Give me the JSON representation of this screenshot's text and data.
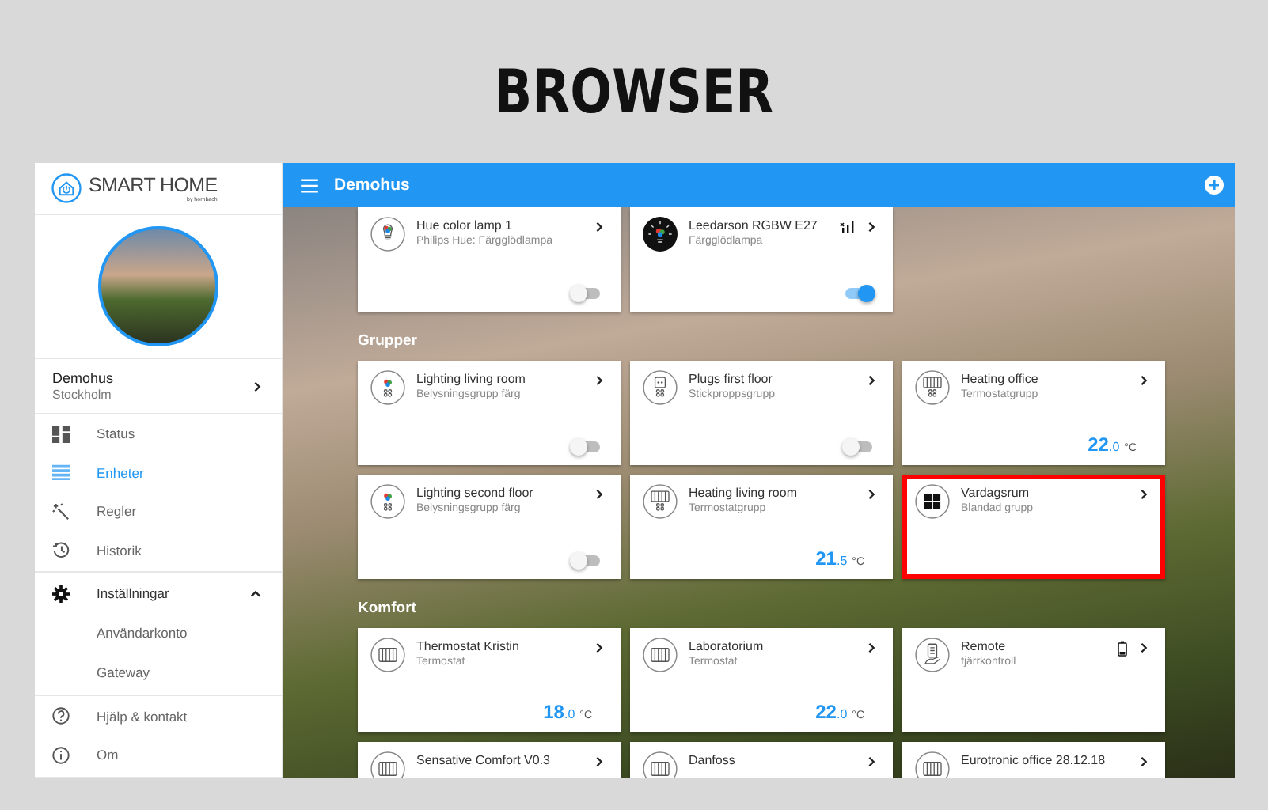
{
  "page_heading": "BROWSER",
  "sidebar": {
    "logo": {
      "title": "SMART HOME",
      "byline": "by hornbach"
    },
    "user": {
      "name": "Demohus",
      "location": "Stockholm"
    },
    "nav": [
      {
        "kind": "dashboard",
        "label": "Status",
        "selected": false
      },
      {
        "kind": "list",
        "label": "Enheter",
        "selected": true
      },
      {
        "kind": "wand",
        "label": "Regler",
        "selected": false
      },
      {
        "kind": "history",
        "label": "Historik",
        "selected": false
      },
      {
        "kind": "settings",
        "label": "Inställningar",
        "selected": false,
        "expanded": true,
        "children": [
          {
            "label": "Användarkonto",
            "selected": false
          },
          {
            "label": "Gateway",
            "selected": false
          }
        ]
      },
      {
        "kind": "help",
        "label": "Hjälp & kontakt",
        "selected": false
      },
      {
        "kind": "info",
        "label": "Om",
        "selected": false
      }
    ]
  },
  "topbar": {
    "title": "Demohus"
  },
  "sections": [
    {
      "cards": [
        {
          "kind": "lamp",
          "title": "Hue color lamp 1",
          "subtitle": "Philips Hue: Färgglödlampa",
          "toggle": {
            "on": false
          },
          "highlighted": false
        },
        {
          "kind": "lamp-dark",
          "title": "Leedarson RGBW E27",
          "subtitle": "Färgglödlampa",
          "indicator": {
            "kind": "signal"
          },
          "toggle": {
            "on": true
          },
          "highlighted": false
        }
      ]
    },
    {
      "title": "Grupper",
      "cards": [
        {
          "kind": "lamp-group",
          "title": "Lighting living room",
          "subtitle": "Belysningsgrupp färg",
          "toggle": {
            "on": false
          },
          "highlighted": false
        },
        {
          "kind": "plug-group",
          "title": "Plugs first floor",
          "subtitle": "Stickproppsgrupp",
          "toggle": {
            "on": false
          },
          "highlighted": false
        },
        {
          "kind": "radiator-group",
          "title": "Heating office",
          "subtitle": "Termostatgrupp",
          "temperature": {
            "whole": "22",
            "decimal": ".0",
            "unit": "°C"
          },
          "highlighted": false
        },
        {
          "kind": "lamp-group",
          "title": "Lighting second floor",
          "subtitle": "Belysningsgrupp färg",
          "toggle": {
            "on": false
          },
          "highlighted": false
        },
        {
          "kind": "radiator-group",
          "title": "Heating living room",
          "subtitle": "Termostatgrupp",
          "temperature": {
            "whole": "21",
            "decimal": ".5",
            "unit": "°C"
          },
          "highlighted": false
        },
        {
          "kind": "mixed-group",
          "title": "Vardagsrum",
          "subtitle": "Blandad grupp",
          "highlighted": true
        }
      ]
    },
    {
      "title": "Komfort",
      "cards": [
        {
          "kind": "radiator",
          "title": "Thermostat Kristin",
          "subtitle": "Termostat",
          "temperature": {
            "whole": "18",
            "decimal": ".0",
            "unit": "°C"
          },
          "highlighted": false
        },
        {
          "kind": "radiator",
          "title": "Laboratorium",
          "subtitle": "Termostat",
          "temperature": {
            "whole": "22",
            "decimal": ".0",
            "unit": "°C"
          },
          "highlighted": false
        },
        {
          "kind": "remote",
          "title": "Remote",
          "subtitle": "fjärrkontroll",
          "indicator": {
            "kind": "battery"
          },
          "highlighted": false
        },
        {
          "kind": "radiator",
          "title": "Sensative Comfort V0.3",
          "highlighted": false
        },
        {
          "kind": "radiator",
          "title": "Danfoss",
          "highlighted": false
        },
        {
          "kind": "radiator",
          "title": "Eurotronic office 28.12.18",
          "highlighted": false
        }
      ]
    }
  ]
}
